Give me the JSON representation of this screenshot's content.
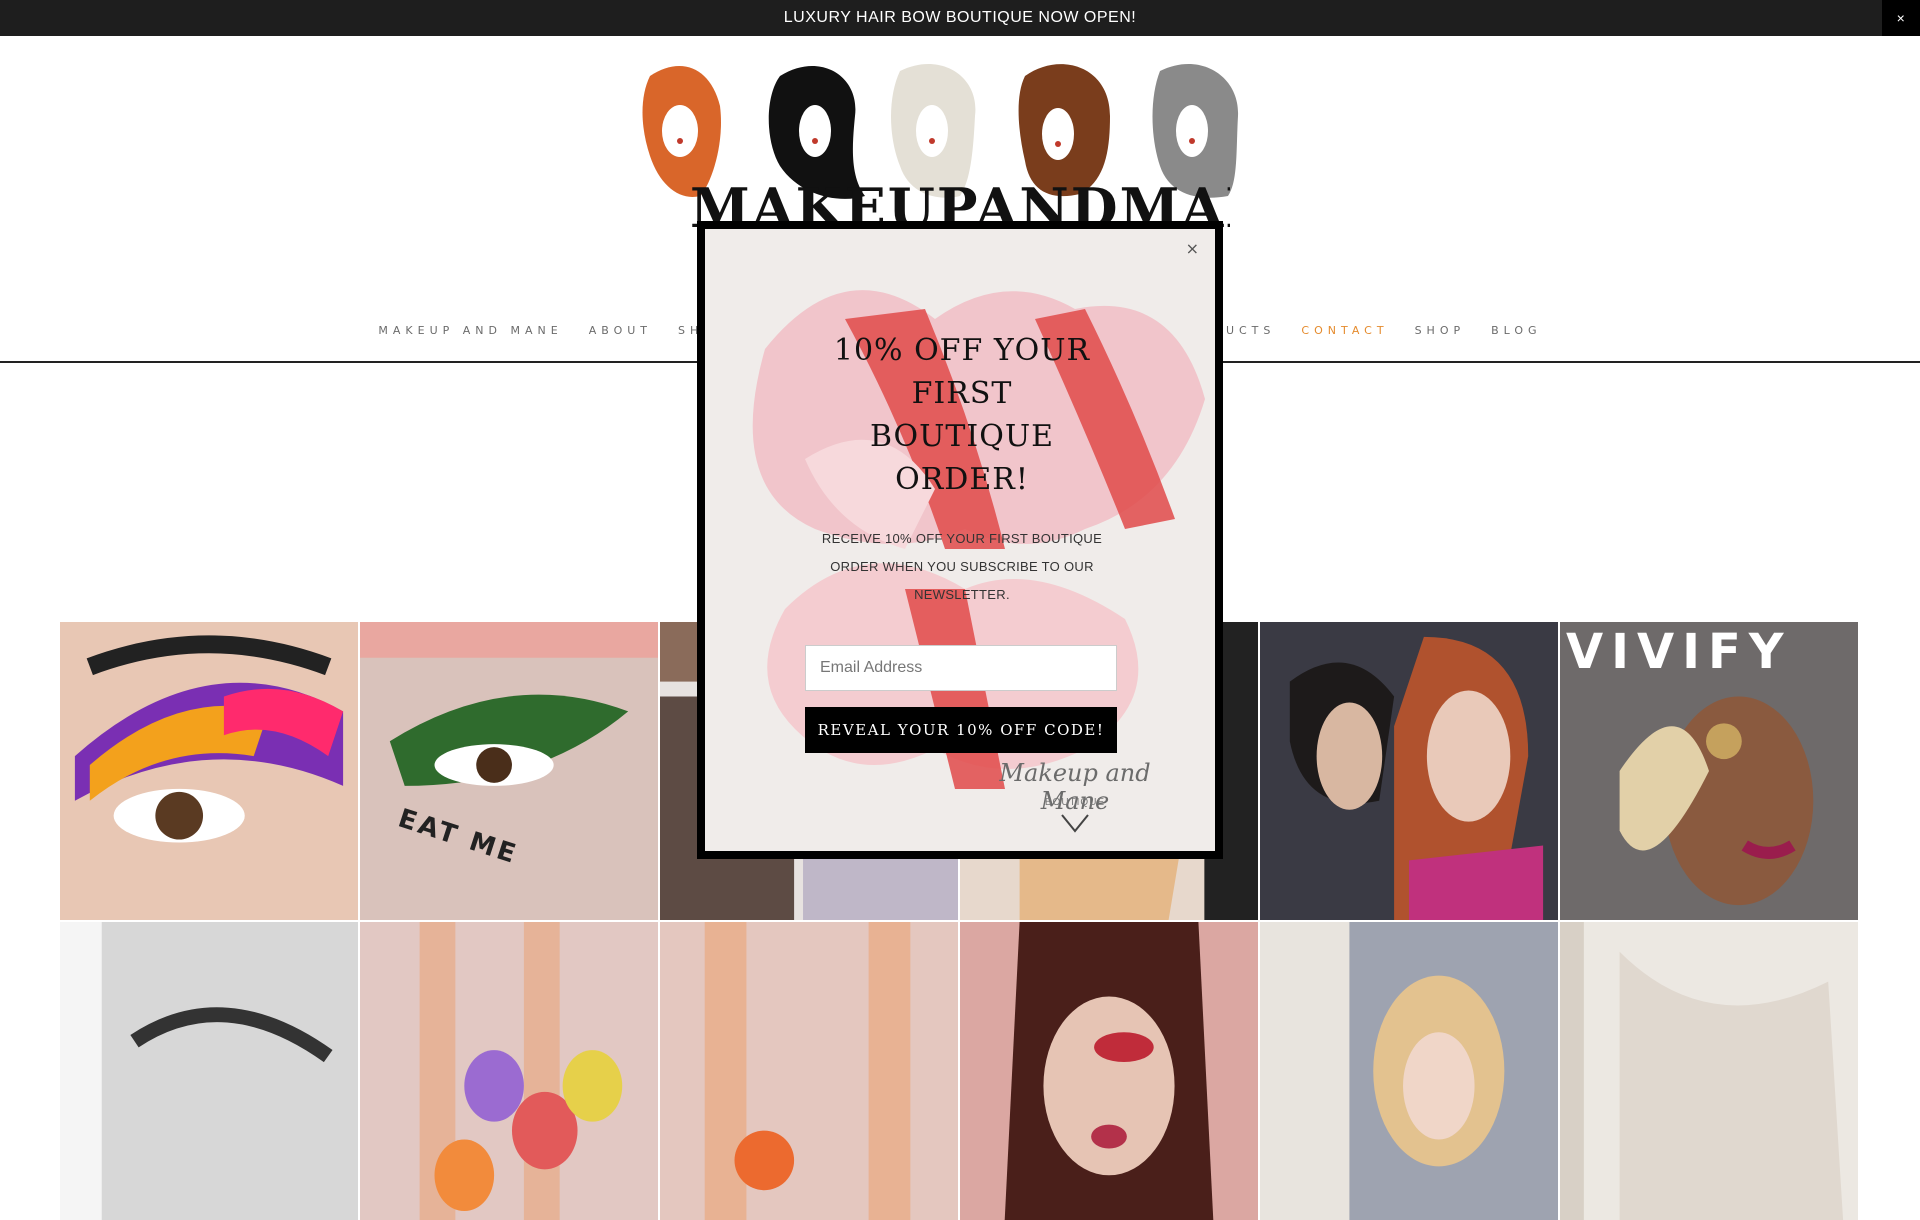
{
  "announcement": {
    "text": "LUXURY HAIR BOW BOUTIQUE NOW OPEN!",
    "close_label": "×"
  },
  "logo": {
    "wordmark": "MAKEUPANDMANE"
  },
  "nav": {
    "items": [
      {
        "label": "MAKEUP AND MANE",
        "active": false
      },
      {
        "label": "ABOUT",
        "active": false
      },
      {
        "label": "SHOP",
        "active": false
      },
      {
        "label": "PRODUCTS",
        "active": false
      },
      {
        "label": "CONTACT",
        "active": true
      },
      {
        "label": "SHOP",
        "active": false
      },
      {
        "label": "BLOG",
        "active": false
      }
    ]
  },
  "modal": {
    "close_label": "×",
    "title": "10% OFF YOUR FIRST BOUTIQUE ORDER!",
    "description": "RECEIVE 10% OFF YOUR FIRST BOUTIQUE ORDER WHEN YOU SUBSCRIBE TO OUR NEWSLETTER.",
    "email_placeholder": "Email Address",
    "cta_label": "REVEAL YOUR 10% OFF CODE!",
    "brand_script": "Makeup and Mane",
    "brand_sub": "BOUTIQUE"
  },
  "gallery": {
    "tiles": [
      {
        "caption": ""
      },
      {
        "caption": "EAT ME"
      },
      {
        "caption": ""
      },
      {
        "caption": ""
      },
      {
        "caption": ""
      },
      {
        "caption": "VIVIFY"
      },
      {
        "caption": ""
      },
      {
        "caption": ""
      },
      {
        "caption": ""
      },
      {
        "caption": ""
      },
      {
        "caption": ""
      },
      {
        "caption": ""
      }
    ]
  },
  "colors": {
    "accent": "#e58b2d",
    "bar": "#1e1e1e",
    "nav_text": "#6b6b6b"
  }
}
